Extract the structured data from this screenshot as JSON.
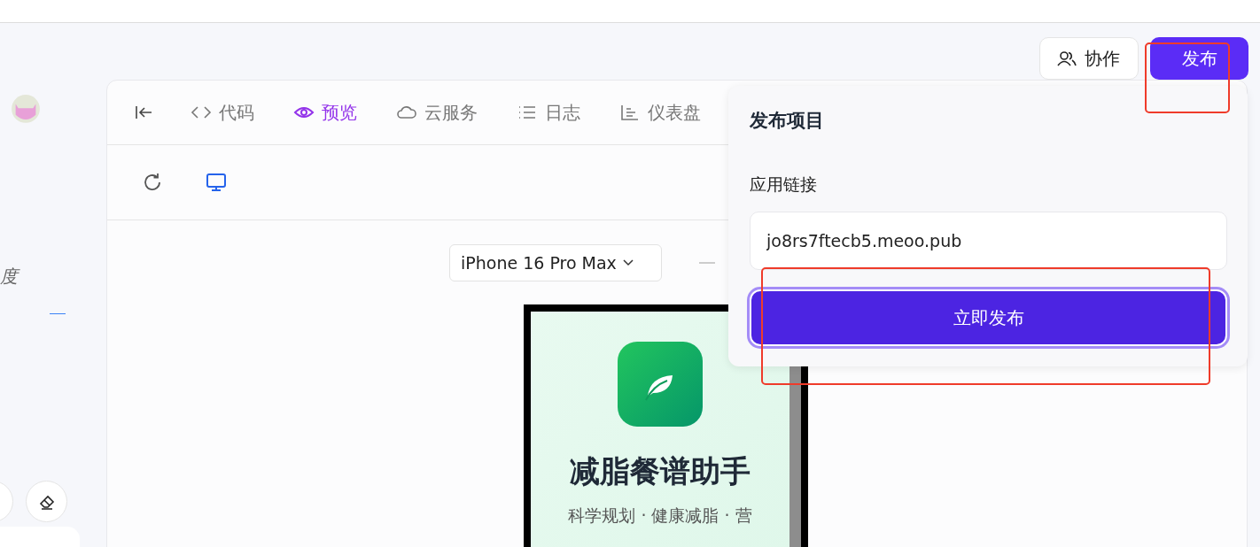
{
  "sidebar": {
    "partial_label": "度"
  },
  "header": {
    "buttons": [
      {
        "label": "协作",
        "kind": "secondary",
        "highlighted": false
      },
      {
        "label": "发布",
        "kind": "primary",
        "highlighted": true
      }
    ]
  },
  "tabs": [
    {
      "label": "代码",
      "selected": false
    },
    {
      "label": "预览",
      "selected": true
    },
    {
      "label": "云服务",
      "selected": false
    },
    {
      "label": "日志",
      "selected": false
    },
    {
      "label": "仪表盘",
      "selected": false
    }
  ],
  "device_select": {
    "value": "iPhone 16 Pro Max"
  },
  "phone_preview": {
    "title": "减脂餐谱助手",
    "subtitle": "科学规划 · 健康减脂 · 营"
  },
  "publish_popover": {
    "title": "发布项目",
    "link_label": "应用链接",
    "link_value": "jo8rs7ftecb5.meoo.pub",
    "button": {
      "label": "立即发布",
      "highlighted": true
    }
  }
}
